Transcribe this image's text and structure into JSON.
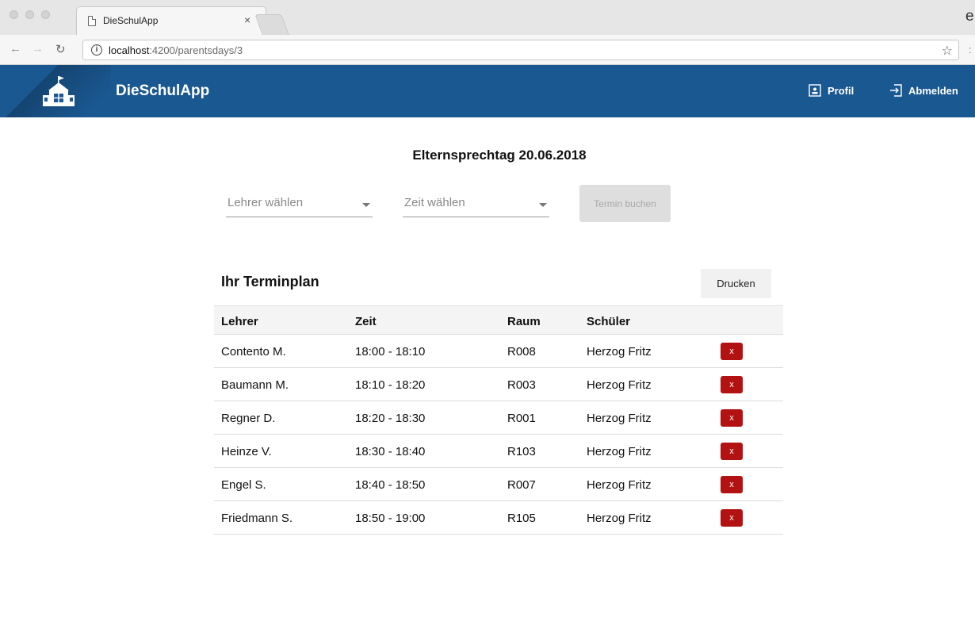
{
  "browser": {
    "tab_title": "DieSchulApp",
    "tab_close": "×",
    "url_host": "localhost",
    "url_path": ":4200/parentsdays/3",
    "profile_glyph": "e",
    "star": "☆",
    "menu": ":"
  },
  "header": {
    "brand": "DieSchulApp",
    "profil_label": "Profil",
    "abmelden_label": "Abmelden",
    "color": "#1a5891"
  },
  "page": {
    "title": "Elternsprechtag 20.06.2018"
  },
  "booking": {
    "teacher_select": "Lehrer wählen",
    "time_select": "Zeit wählen",
    "book_button": "Termin buchen"
  },
  "schedule": {
    "title": "Ihr Terminplan",
    "print_button": "Drucken",
    "columns": [
      "Lehrer",
      "Zeit",
      "Raum",
      "Schüler"
    ],
    "delete_label": "x",
    "delete_color": "#b31212",
    "rows": [
      {
        "teacher": "Contento M.",
        "time": "18:00 - 18:10",
        "room": "R008",
        "student": "Herzog Fritz"
      },
      {
        "teacher": "Baumann M.",
        "time": "18:10 - 18:20",
        "room": "R003",
        "student": "Herzog Fritz"
      },
      {
        "teacher": "Regner D.",
        "time": "18:20 - 18:30",
        "room": "R001",
        "student": "Herzog Fritz"
      },
      {
        "teacher": "Heinze V.",
        "time": "18:30 - 18:40",
        "room": "R103",
        "student": "Herzog Fritz"
      },
      {
        "teacher": "Engel S.",
        "time": "18:40 - 18:50",
        "room": "R007",
        "student": "Herzog Fritz"
      },
      {
        "teacher": "Friedmann S.",
        "time": "18:50 - 19:00",
        "room": "R105",
        "student": "Herzog Fritz"
      }
    ]
  }
}
